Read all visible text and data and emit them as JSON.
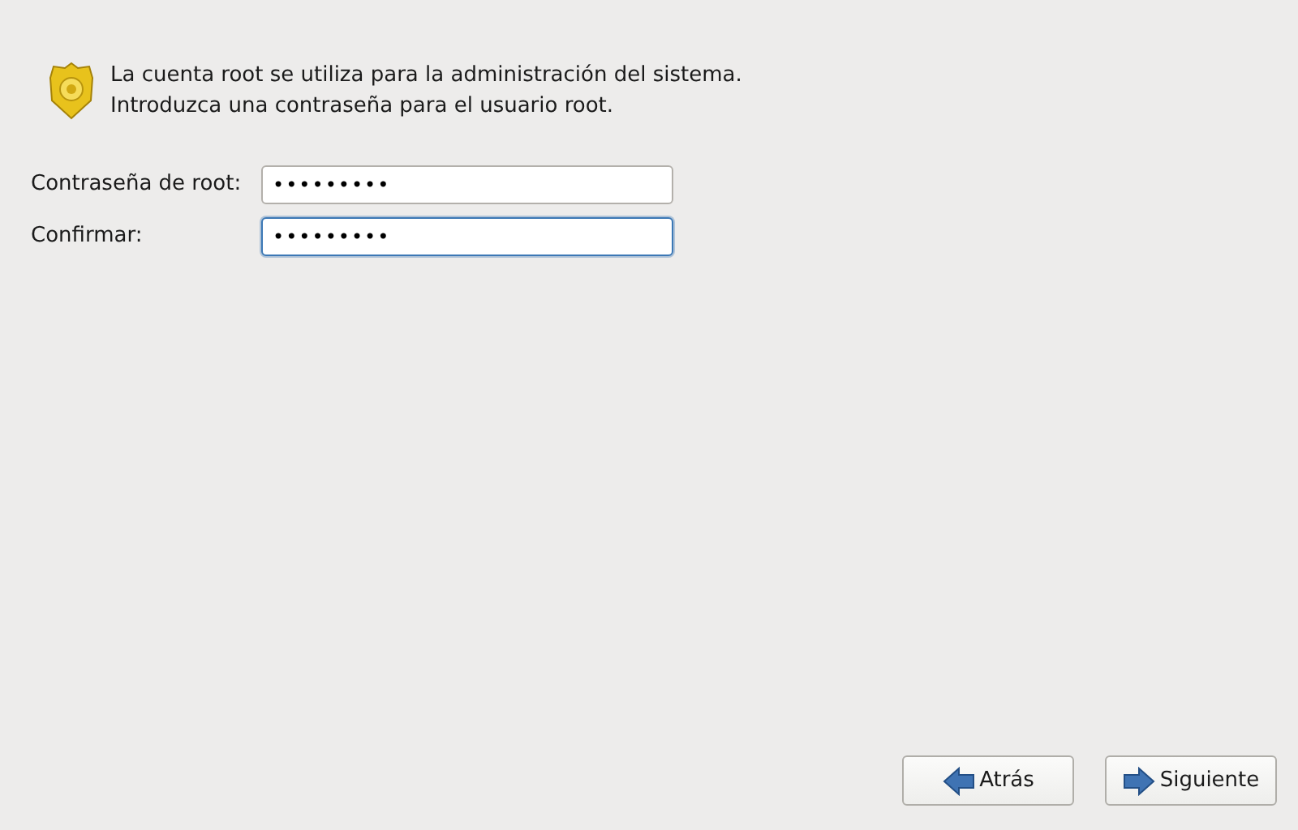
{
  "intro": "La cuenta root se utiliza para la administración del sistema. Introduzca una contraseña para el usuario root.",
  "fields": [
    {
      "label": "Contraseña de root:",
      "value": "•••••••••",
      "focused": false
    },
    {
      "label": "Confirmar:",
      "value": "•••••••••",
      "focused": true
    }
  ],
  "buttons": [
    {
      "label": "Atrás",
      "kind": "back"
    },
    {
      "label": "Siguiente",
      "kind": "next"
    }
  ]
}
